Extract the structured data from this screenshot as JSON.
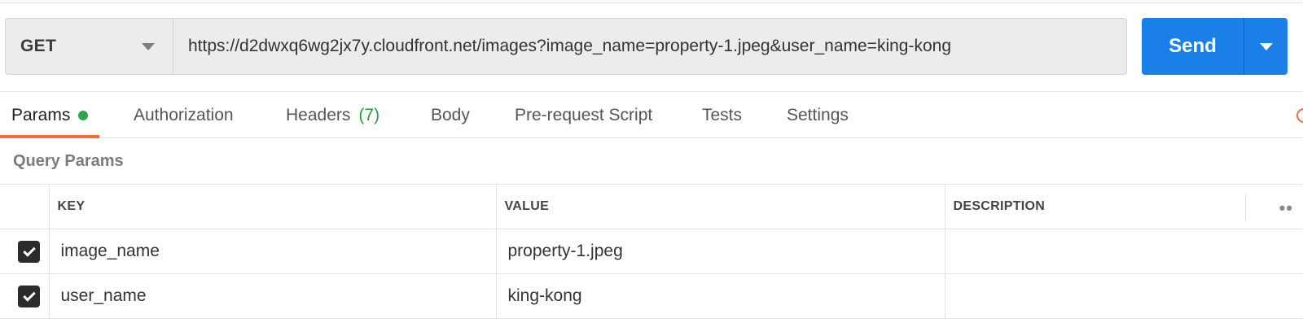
{
  "request": {
    "method": "GET",
    "url": "https://d2dwxq6wg2jx7y.cloudfront.net/images?image_name=property-1.jpeg&user_name=king-kong",
    "send_label": "Send"
  },
  "tabs": [
    {
      "label": "Params",
      "active": true,
      "indicator": "green-dot"
    },
    {
      "label": "Authorization"
    },
    {
      "label": "Headers",
      "count": "(7)"
    },
    {
      "label": "Body"
    },
    {
      "label": "Pre-request Script"
    },
    {
      "label": "Tests"
    },
    {
      "label": "Settings"
    }
  ],
  "query_params": {
    "title": "Query Params",
    "columns": [
      "KEY",
      "VALUE",
      "DESCRIPTION"
    ],
    "more_icon": "ellipsis-icon",
    "rows": [
      {
        "checked": true,
        "key": "image_name",
        "value": "property-1.jpeg",
        "description": ""
      },
      {
        "checked": true,
        "key": "user_name",
        "value": "king-kong",
        "description": ""
      }
    ]
  },
  "colors": {
    "send": "#1a7fe6",
    "active_tab_underline": "#f26b3a",
    "params_dot": "#2ea44f",
    "headers_count": "#2b9a3e"
  }
}
